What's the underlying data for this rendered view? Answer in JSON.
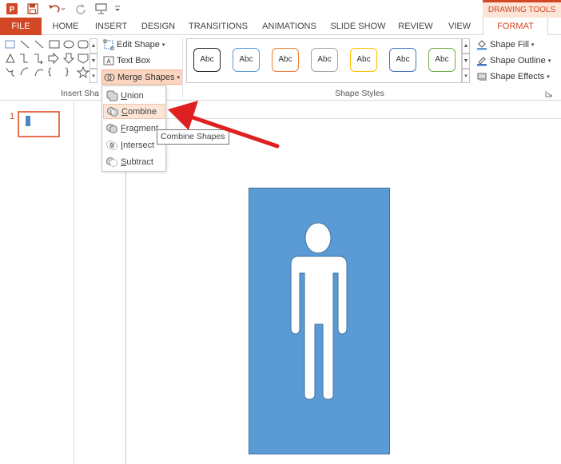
{
  "qat": {
    "app_icon": "powerpoint-icon",
    "save_icon": "save-icon",
    "undo_icon": "undo-icon",
    "redo_icon": "redo-icon",
    "present_icon": "start-presentation-icon",
    "customize_icon": "customize-qat-icon"
  },
  "context": {
    "drawing_tools": "DRAWING TOOLS"
  },
  "tabs": {
    "file": "FILE",
    "home": "HOME",
    "insert": "INSERT",
    "design": "DESIGN",
    "transitions": "TRANSITIONS",
    "animations": "ANIMATIONS",
    "slideshow": "SLIDE SHOW",
    "review": "REVIEW",
    "view": "VIEW",
    "format": "FORMAT"
  },
  "ribbon": {
    "insert_shapes": {
      "edit_shape": "Edit Shape",
      "text_box": "Text Box",
      "merge_shapes": "Merge Shapes",
      "label": "Insert Sha"
    },
    "shape_styles": {
      "label": "Shape Styles",
      "swatches": [
        {
          "label": "Abc",
          "border": "#262626"
        },
        {
          "label": "Abc",
          "border": "#5b9bd5"
        },
        {
          "label": "Abc",
          "border": "#ed7d31"
        },
        {
          "label": "Abc",
          "border": "#a5a5a5"
        },
        {
          "label": "Abc",
          "border": "#ffc000"
        },
        {
          "label": "Abc",
          "border": "#4472c4"
        },
        {
          "label": "Abc",
          "border": "#70ad47"
        }
      ],
      "shape_fill": "Shape Fill",
      "shape_outline": "Shape Outline",
      "shape_effects": "Shape Effects"
    }
  },
  "merge_menu": {
    "items": [
      {
        "label": "Union",
        "first": "U",
        "rest": "nion"
      },
      {
        "label": "Combine",
        "first": "C",
        "rest": "ombine"
      },
      {
        "label": "Fragment",
        "first": "F",
        "rest": "ragment"
      },
      {
        "label": "Intersect",
        "first": "I",
        "rest": "ntersect"
      },
      {
        "label": "Subtract",
        "first": "S",
        "rest": "ubtract"
      }
    ],
    "tooltip": "Combine Shapes"
  },
  "slides": {
    "number": "1"
  },
  "colors": {
    "accent": "#d24726",
    "shape_fill": "#5b9bd5",
    "arrow": "#e02020"
  }
}
